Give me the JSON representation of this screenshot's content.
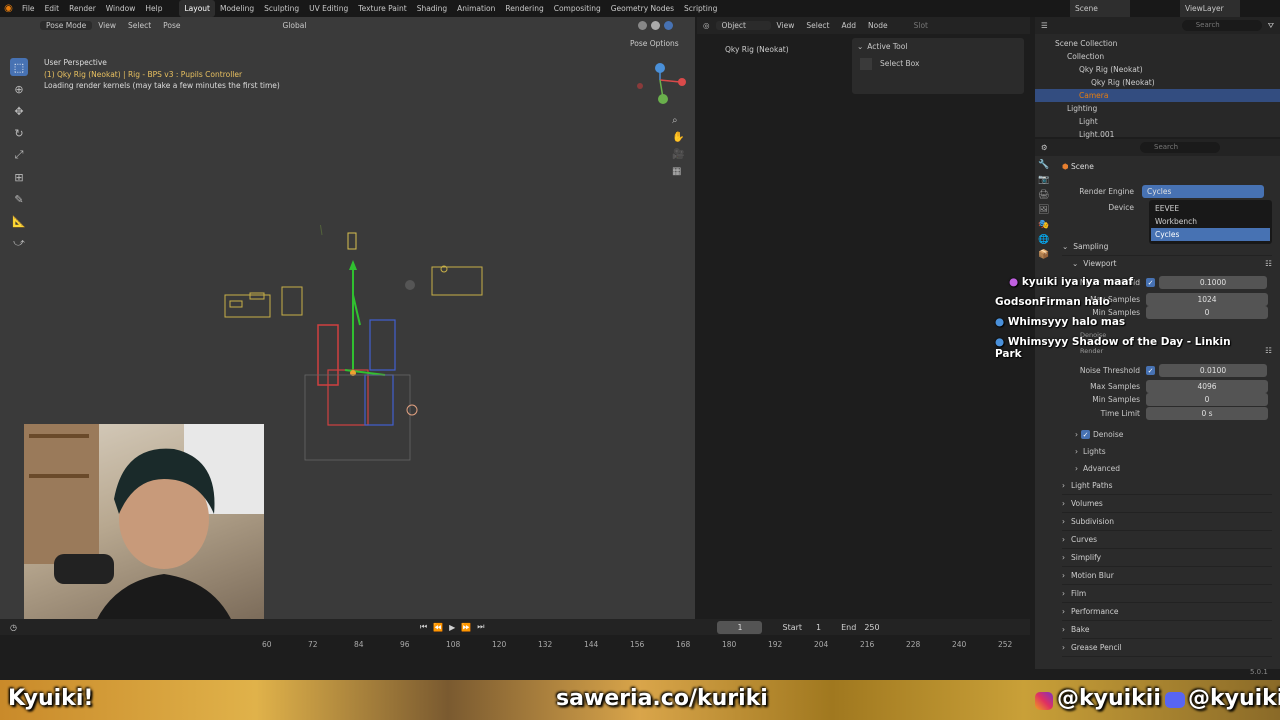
{
  "topbar": {
    "menus": [
      "File",
      "Edit",
      "Render",
      "Window",
      "Help"
    ],
    "workspaces": [
      "Layout",
      "Modeling",
      "Sculpting",
      "UV Editing",
      "Texture Paint",
      "Shading",
      "Animation",
      "Rendering",
      "Compositing",
      "Geometry Nodes",
      "Scripting"
    ],
    "active_workspace": "Layout",
    "scene": "Scene",
    "view_layer": "ViewLayer"
  },
  "viewport": {
    "mode": "Pose Mode",
    "menus": [
      "View",
      "Select",
      "Pose"
    ],
    "orientation": "Global",
    "pose_options": "Pose Options",
    "perspective": "User Perspective",
    "object_info": "(1) Qky Rig (Neokat) | Rig - BPS v3 : Pupils Controller",
    "status": "Loading render kernels (may take a few minutes the first time)"
  },
  "node_editor": {
    "mode": "Object",
    "menus": [
      "View",
      "Select",
      "Add",
      "Node"
    ],
    "slot": "Slot",
    "breadcrumb": "Qky Rig (Neokat)",
    "active_tool_title": "Active Tool",
    "active_tool": "Select Box"
  },
  "outliner": {
    "search_placeholder": "Search",
    "items": [
      {
        "label": "Scene Collection",
        "indent": 0
      },
      {
        "label": "Collection",
        "indent": 1
      },
      {
        "label": "Qky Rig (Neokat)",
        "indent": 2
      },
      {
        "label": "Qky Rig (Neokat)",
        "indent": 3
      },
      {
        "label": "Camera",
        "indent": 2
      },
      {
        "label": "Lighting",
        "indent": 1
      },
      {
        "label": "Light",
        "indent": 2
      },
      {
        "label": "Light.001",
        "indent": 2
      }
    ]
  },
  "properties": {
    "search_placeholder": "Search",
    "context": "Scene",
    "render_engine_label": "Render Engine",
    "render_engine_value": "Cycles",
    "device_label": "Device",
    "engine_options": [
      "EEVEE",
      "Workbench",
      "Cycles"
    ],
    "sampling": "Sampling",
    "viewport": "Viewport",
    "noise_threshold_label": "Noise Threshold",
    "vp_noise_threshold": "0.1000",
    "max_samples_label": "Max Samples",
    "vp_max_samples": "1024",
    "min_samples_label": "Min Samples",
    "vp_min_samples": "0",
    "denoise_label": "Denoise",
    "render": "Render",
    "r_noise_threshold": "0.0100",
    "r_max_samples": "4096",
    "r_min_samples": "0",
    "time_limit_label": "Time Limit",
    "r_time_limit": "0 s",
    "sub_lights": "Lights",
    "sub_advanced": "Advanced",
    "sections": [
      "Light Paths",
      "Volumes",
      "Subdivision",
      "Curves",
      "Simplify",
      "Motion Blur",
      "Film",
      "Performance",
      "Bake",
      "Grease Pencil"
    ],
    "version": "5.0.1"
  },
  "timeline": {
    "current_frame": "1",
    "start_label": "Start",
    "start": "1",
    "end_label": "End",
    "end": "250",
    "ticks": [
      "60",
      "72",
      "84",
      "96",
      "108",
      "120",
      "132",
      "144",
      "156",
      "168",
      "180",
      "192",
      "204",
      "216",
      "228",
      "240",
      "252"
    ]
  },
  "chat": [
    {
      "user": "kyuiki",
      "message": "iya iya maaf"
    },
    {
      "user": "GodsonFirman",
      "message": "halo"
    },
    {
      "user": "Whimsyyy",
      "message": "halo mas"
    },
    {
      "user": "Whimsyyy",
      "message": "Shadow of the Day - Linkin Park"
    }
  ],
  "banner": {
    "name": "Kyuiki!",
    "saweria": "saweria.co/kuriki",
    "instagram": "@kyuikii",
    "discord": "@kyuiki"
  },
  "colors": {
    "accent": "#4772b3",
    "orange": "#e87d0d"
  }
}
